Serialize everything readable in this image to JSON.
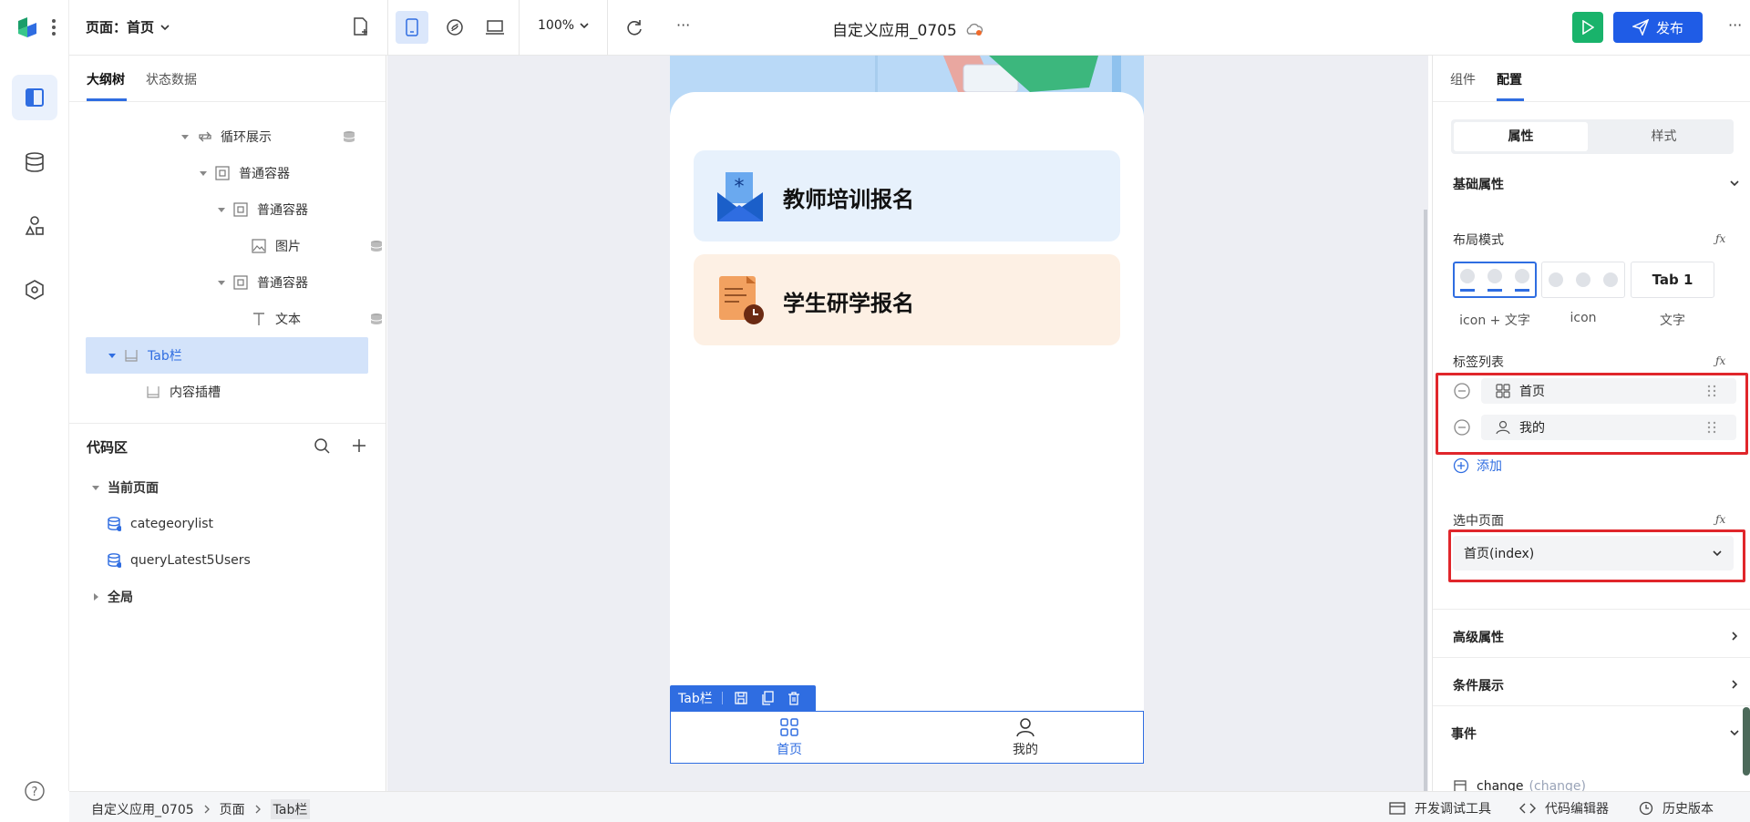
{
  "topbar": {
    "page_selector": "页面：首页",
    "zoom": "100%",
    "more": "···",
    "app_title": "自定义应用_0705",
    "publish_label": "发布"
  },
  "left_panel": {
    "tabs": [
      "大纲树",
      "状态数据"
    ],
    "tree": [
      {
        "label": "循环展示",
        "indent": 0
      },
      {
        "label": "普通容器",
        "indent": 1
      },
      {
        "label": "普通容器",
        "indent": 2
      },
      {
        "label": "图片",
        "indent": 3
      },
      {
        "label": "普通容器",
        "indent": 2
      },
      {
        "label": "文本",
        "indent": 3
      },
      {
        "label": "Tab栏",
        "indent": 0
      },
      {
        "label": "内容插槽",
        "indent": 1
      }
    ],
    "code_area": {
      "title": "代码区",
      "current_page": "当前页面",
      "items": [
        "categeorylist",
        "queryLatest5Users"
      ],
      "global": "全局"
    }
  },
  "phone": {
    "cards": [
      {
        "label": "教师培训报名",
        "bg": "#e7f1fc"
      },
      {
        "label": "学生研学报名",
        "bg": "#fdf0e4"
      }
    ],
    "tabbar_tag": "Tab栏",
    "tabs": [
      {
        "label": "首页",
        "color": "#2f6de1"
      },
      {
        "label": "我的",
        "color": "#333333"
      }
    ]
  },
  "right_panel": {
    "tabs": [
      "组件",
      "配置"
    ],
    "segment": [
      "属性",
      "样式"
    ],
    "basic_section": "基础属性",
    "layout_label": "布局模式",
    "layout_options": [
      "icon + 文字",
      "icon",
      "文字"
    ],
    "layout_text_preview": "Tab 1",
    "tab_list_label": "标签列表",
    "tab_items": [
      "首页",
      "我的"
    ],
    "add_label": "添加",
    "selected_page_label": "选中页面",
    "selected_page_value": "首页(index)",
    "advanced_section": "高级属性",
    "condition_section": "条件展示",
    "events_section": "事件",
    "event_item": "change",
    "event_item_sub": "(change)"
  },
  "statusbar": {
    "breadcrumb": [
      "自定义应用_0705",
      "页面",
      "Tab栏"
    ],
    "dev_tools": "开发调试工具",
    "code_editor": "代码编辑器",
    "version": "历史版本"
  },
  "colors": {
    "accent": "#2f6de1",
    "publish_bg": "#1f5ce6",
    "run_bg": "#19b36b",
    "highlight": "#e0262b"
  }
}
